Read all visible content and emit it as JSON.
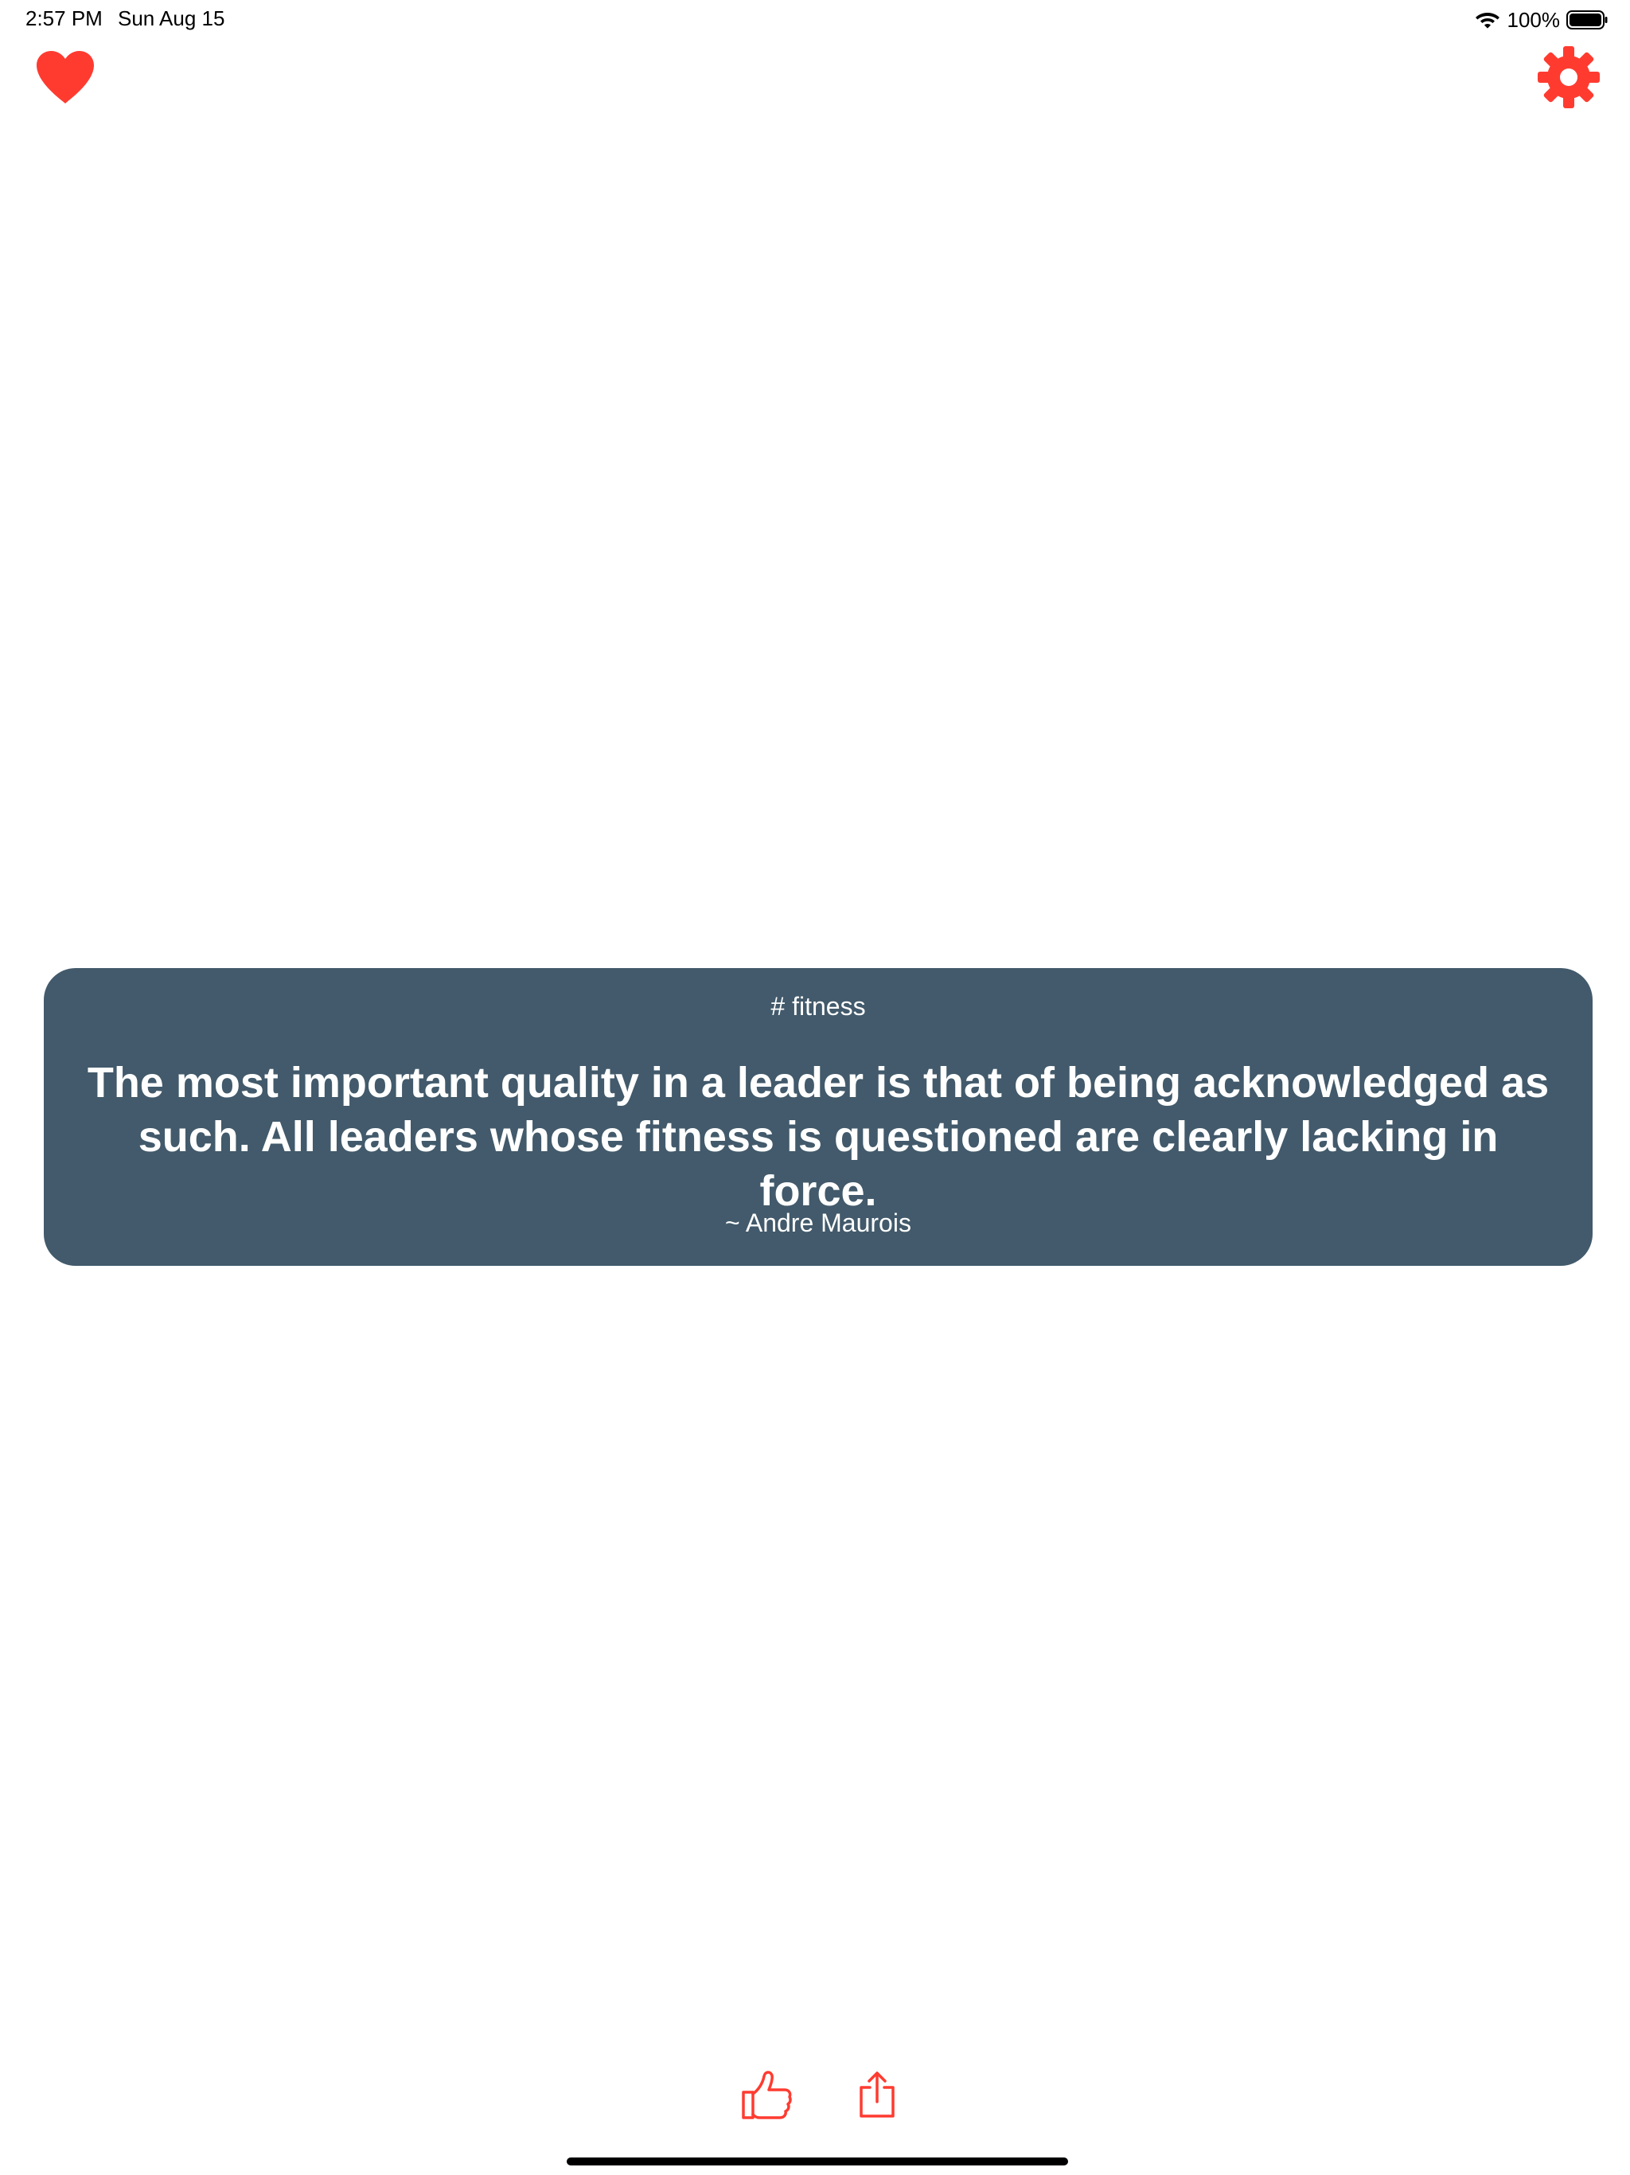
{
  "status_bar": {
    "time": "2:57 PM",
    "date": "Sun Aug 15",
    "battery": "100%"
  },
  "header": {
    "favorites_icon": "heart-icon",
    "settings_icon": "gear-icon"
  },
  "quote": {
    "tag": "#  fitness",
    "text": "The most important quality in a leader is that of being acknowledged as such. All leaders whose fitness is questioned are clearly lacking in force.",
    "author": "~  Andre Maurois"
  },
  "actions": {
    "like_icon": "thumbs-up-icon",
    "share_icon": "share-icon"
  },
  "colors": {
    "accent": "#ff3b30",
    "card_background": "#425a6b",
    "card_text": "#ffffff"
  }
}
